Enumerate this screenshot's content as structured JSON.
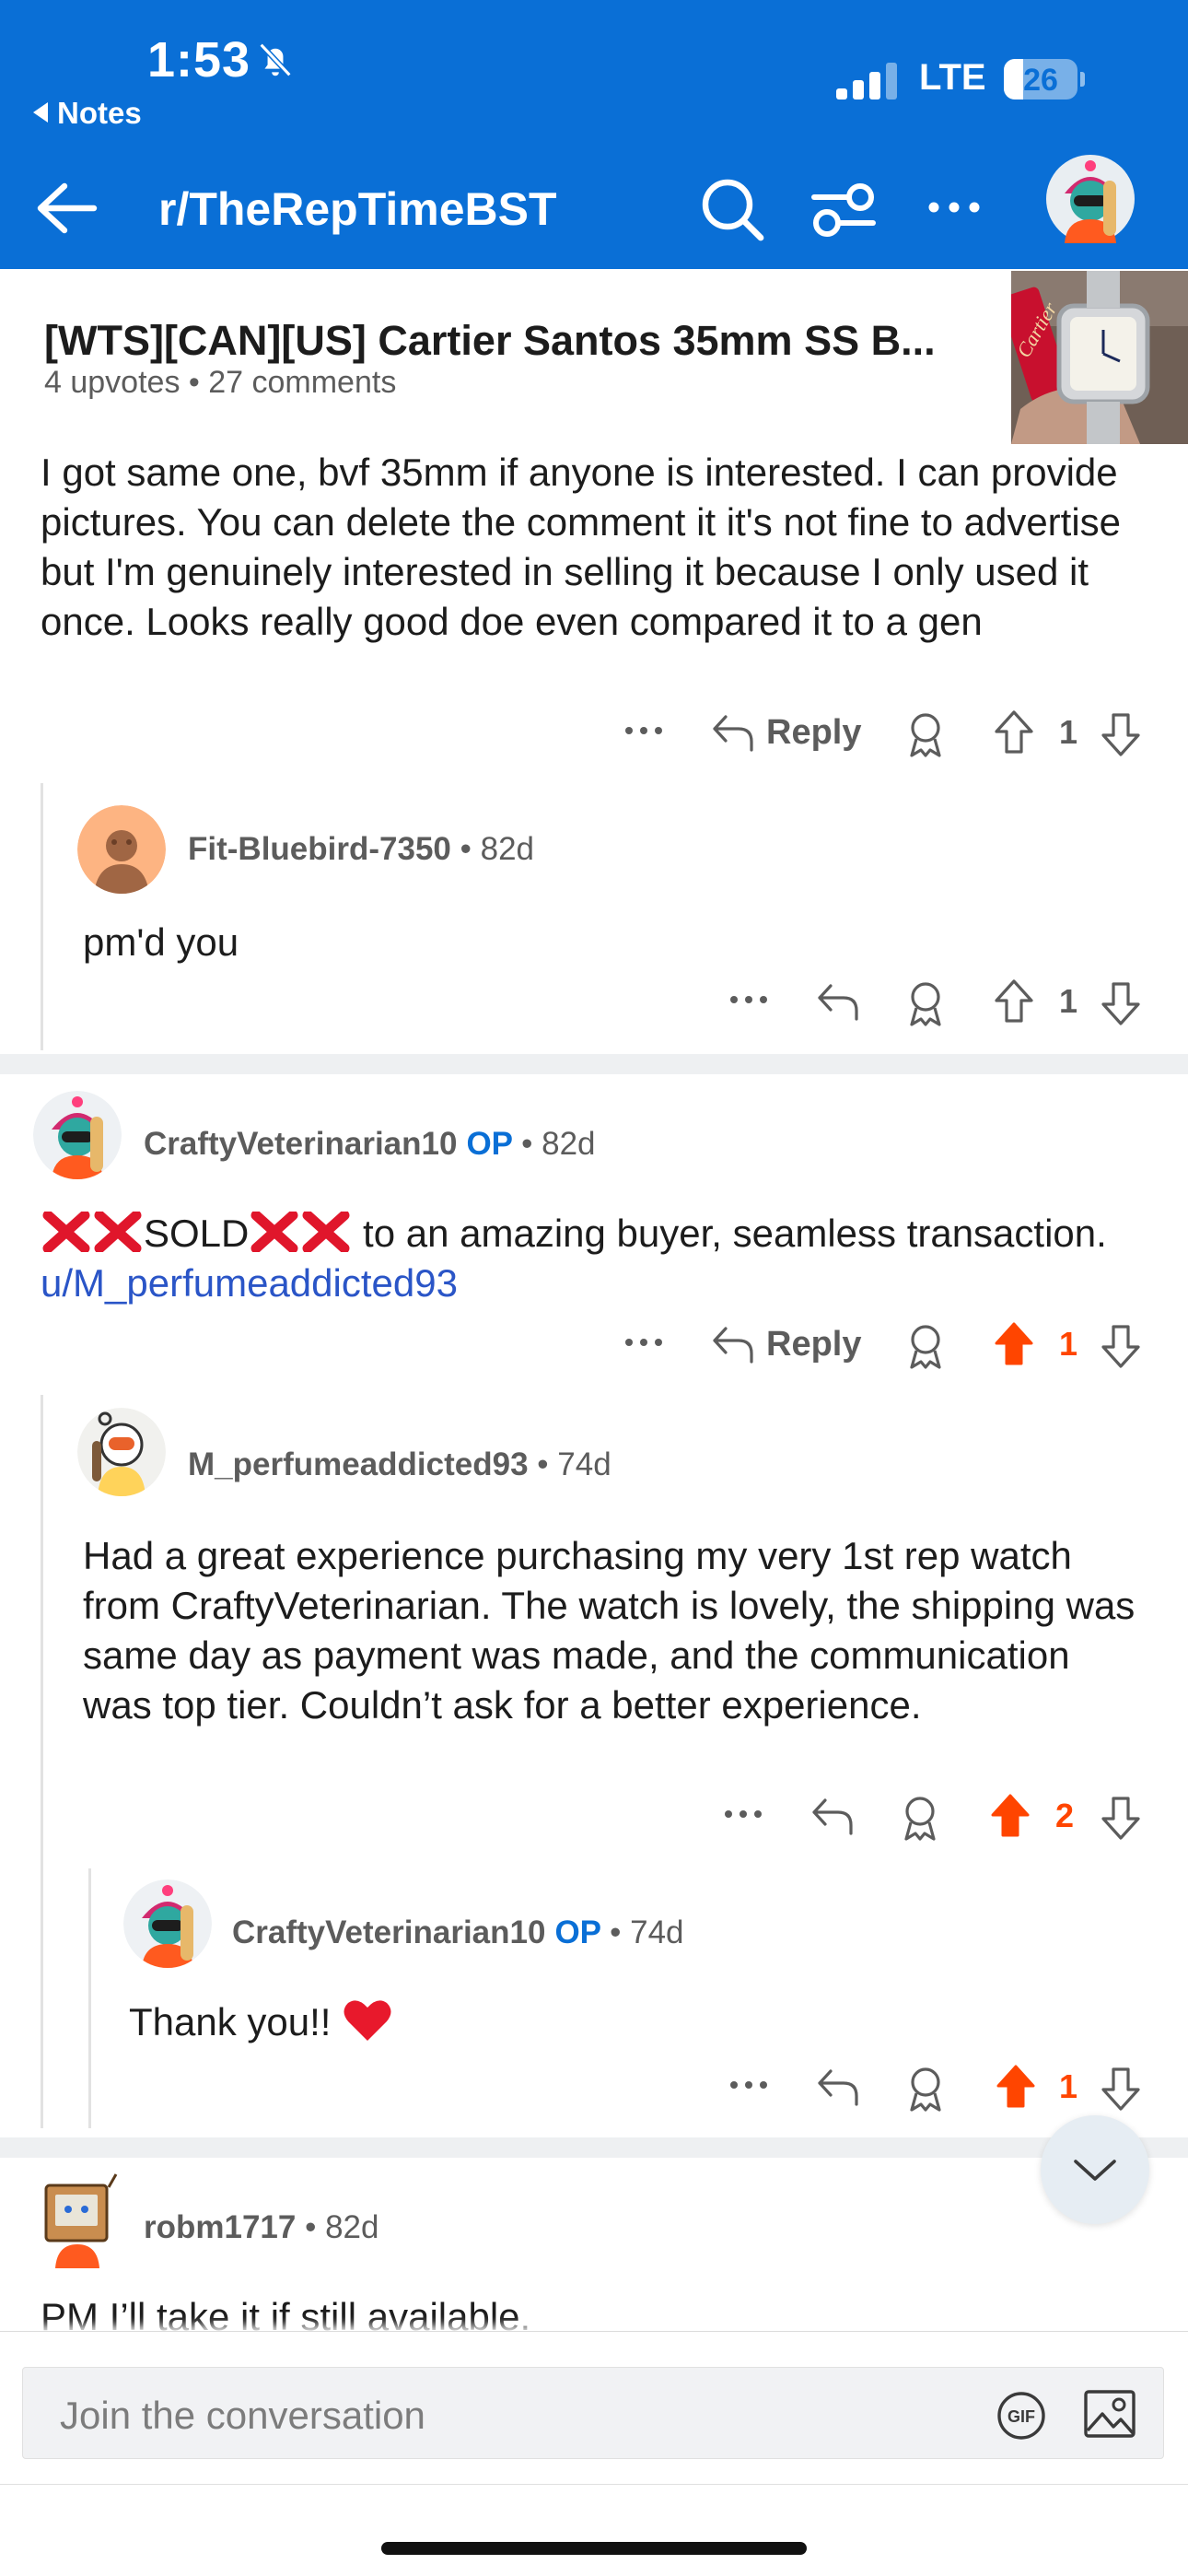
{
  "status_bar": {
    "time": "1:53",
    "back_app": "Notes",
    "network": "LTE",
    "battery": "26",
    "battery_level": 0.26
  },
  "header": {
    "subreddit": "r/TheRepTimeBST"
  },
  "post": {
    "title": "[WTS][CAN][US] Cartier Santos 35mm SS B...",
    "meta": "4 upvotes • 27 comments",
    "thumb_brand": "Cartier"
  },
  "comments": [
    {
      "text": "I got same one, bvf 35mm if anyone is interested. I can provide pictures. You can delete the comment it it's not fine to advertise but I'm genuinely interested in selling it because I only used it once. Looks really good doe even compared it to a gen",
      "reply_label": "Reply",
      "votes": "1"
    },
    {
      "username": "Fit-Bluebird-7350",
      "age": "• 82d",
      "text": "pm'd you",
      "votes": "1"
    },
    {
      "username": "CraftyVeterinarian10",
      "op_badge": "OP",
      "age": "• 82d",
      "text_sold": "SOLD",
      "text_rest": " to an amazing buyer, seamless transaction. ",
      "mention": "u/M_perfumeaddicted93",
      "reply_label": "Reply",
      "votes": "1"
    },
    {
      "username": "M_perfumeaddicted93",
      "age": "• 74d",
      "text": "Had a great experience purchasing my very 1st rep watch from CraftyVeterinarian. The watch is lovely, the shipping was same day as payment was made, and the communication was top tier. Couldn’t ask for a better experience.",
      "votes": "2"
    },
    {
      "username": "CraftyVeterinarian10",
      "op_badge": "OP",
      "age": "• 74d",
      "text": "Thank you!! ",
      "votes": "1"
    },
    {
      "username": "robm1717",
      "age": "• 82d",
      "text": "PM I’ll take it if still available."
    }
  ],
  "composer": {
    "placeholder": "Join the conversation",
    "gif_label": "GIF"
  },
  "colors": {
    "header_bg": "#0a6fd6",
    "upvote_active": "#ff4500",
    "link": "#2a55c7",
    "op_badge": "#0a6fd6"
  }
}
